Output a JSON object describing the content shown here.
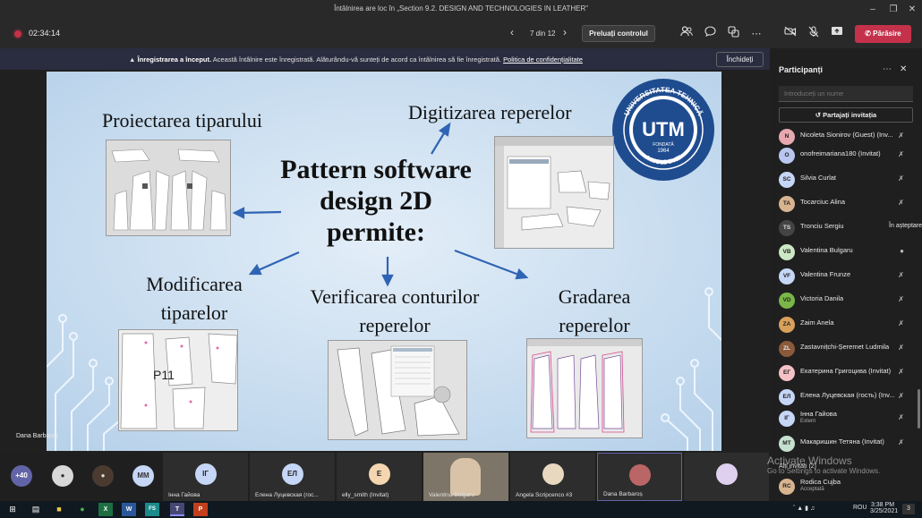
{
  "window": {
    "title": "Întâlnirea are loc în „Section 9.2. DESIGN AND TECHNOLOGIES IN LEATHER”"
  },
  "callbar": {
    "timer": "02:34:14",
    "page": "7 din 12",
    "control_button": "Preluați controlul",
    "leave_button": "Părăsire"
  },
  "banner": {
    "bold": "Înregistrarea a început.",
    "text": " Această întâlnire este înregistrată. Alăturându-vă sunteți de acord ca întâlnirea să fie înregistrată. ",
    "link": "Politica de confidențialitate",
    "close": "Închideți"
  },
  "slide": {
    "title_lines": [
      "Pattern software",
      "design 2D",
      "permite:"
    ],
    "proiectarea": "Proiectarea  tiparului",
    "digitizarea": "Digitizarea reperelor",
    "modificarea": [
      "Modificarea",
      "tiparelor"
    ],
    "verificarea": [
      "Verificarea conturilor",
      "reperelor"
    ],
    "gradarea": [
      "Gradarea",
      "reperelor"
    ],
    "logo_text": "UTM",
    "logo_ring_top": "UNIVERSITATEA TEHNICĂ",
    "logo_ring_bottom": "A MOLDOVEI",
    "logo_year_label": "FONDATĂ",
    "logo_year": "1964",
    "thumb_label": "P11"
  },
  "presenter_label": "Dana Barbaroș",
  "strip": {
    "overflow_count": "+40",
    "mm": "MM",
    "tiles": [
      {
        "initials": "IГ",
        "name": "Інна Гайова"
      },
      {
        "initials": "ЕЛ",
        "name": "Елена Луцевская (гос..."
      },
      {
        "initials": "E",
        "name": "elly_smith (Invitat)"
      },
      {
        "initials": "",
        "name": "Valentina Bulgaru"
      },
      {
        "initials": "",
        "name": "Angela Scripcenco #3"
      },
      {
        "initials": "",
        "name": "Dana Barbaroș"
      },
      {
        "initials": "",
        "name": ""
      }
    ]
  },
  "panel": {
    "title": "Participanți",
    "search_placeholder": "Introduceți un nume",
    "share": "Partajați invitația",
    "people": [
      {
        "initials": "N",
        "name": "Nicoleta Sionirov (Guest) (Inv...",
        "status": "",
        "color": "#e8a8b0"
      },
      {
        "initials": "O",
        "name": "onofreimariana180 (Invitat)",
        "status": "",
        "color": "#b9c6f0"
      },
      {
        "initials": "SC",
        "name": "Silvia Curlat",
        "status": "",
        "color": "#c6d6f6"
      },
      {
        "initials": "TA",
        "name": "Tocarciuc Alina",
        "status": "",
        "color": "#d8b48f"
      },
      {
        "initials": "TS",
        "name": "Tronciu Sergiu",
        "status": "În așteptare",
        "color": "#444"
      },
      {
        "initials": "VB",
        "name": "Valentina Bulgaru",
        "status": "",
        "color": "#cde8c4"
      },
      {
        "initials": "VF",
        "name": "Valentina Frunze",
        "status": "",
        "color": "#c6d6f6"
      },
      {
        "initials": "VD",
        "name": "Victoria Danila",
        "status": "",
        "color": "#7ab648"
      },
      {
        "initials": "ZA",
        "name": "Zaim Anela",
        "status": "",
        "color": "#d9a05b"
      },
      {
        "initials": "ZL",
        "name": "Zastavnițchi-Șeremet Ludmila",
        "status": "",
        "color": "#8a5a3a"
      },
      {
        "initials": "ЕГ",
        "name": "Екатерина Григоцива (Invitat)",
        "status": "",
        "color": "#f3c1c6"
      },
      {
        "initials": "ЕЛ",
        "name": "Елена Луцевская (гость) (Inv...",
        "status": "",
        "color": "#c6d6f6"
      },
      {
        "initials": "IГ",
        "name": "Інна Гайова",
        "sub": "Extern",
        "status": "",
        "color": "#c6d6f6"
      },
      {
        "initials": "МТ",
        "name": "Макаришин Тетяна (Invitat)",
        "status": "",
        "color": "#c6e0d0"
      }
    ],
    "invited_header": "Alți invitați (2)",
    "invited": [
      {
        "initials": "RC",
        "name": "Rodica Cujba",
        "sub": "Acceptată",
        "color": "#d8b48f"
      }
    ]
  },
  "watermark": {
    "line1": "Activate Windows",
    "line2": "Go to Settings to activate Windows."
  },
  "taskbar": {
    "lang": "ROU",
    "time": "3:38 PM",
    "date": "3/25/2021",
    "notif": "3"
  },
  "colors": {
    "leave": "#c4314b",
    "banner_bg": "#2a2c3f",
    "slide_bg": "#c9def0",
    "arrow": "#2f64b4",
    "logo": "#1f4c8f"
  }
}
